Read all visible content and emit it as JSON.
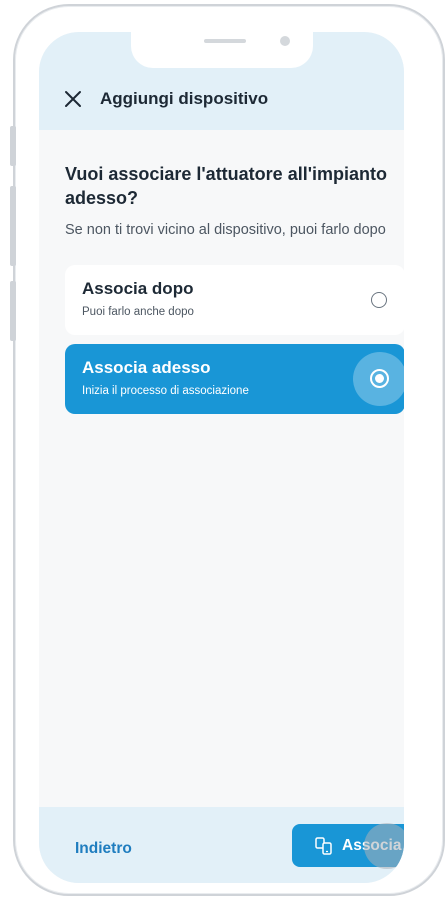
{
  "header": {
    "title": "Aggiungi dispositivo",
    "close_icon": "close-icon"
  },
  "question": "Vuoi associare l'attuatore all'impianto adesso?",
  "hint": "Se non ti trovi vicino al dispositivo, puoi farlo dopo",
  "options": [
    {
      "title": "Associa dopo",
      "subtitle": "Puoi farlo anche dopo",
      "selected": false
    },
    {
      "title": "Associa adesso",
      "subtitle": "Inizia il processo di associazione",
      "selected": true
    }
  ],
  "footer": {
    "back_label": "Indietro",
    "primary_label": "Associa",
    "primary_icon": "pair-devices-icon"
  },
  "colors": {
    "accent": "#1996d6",
    "header_bg": "#e2f0f8",
    "link": "#1f7dbf",
    "text": "#1d2935"
  }
}
